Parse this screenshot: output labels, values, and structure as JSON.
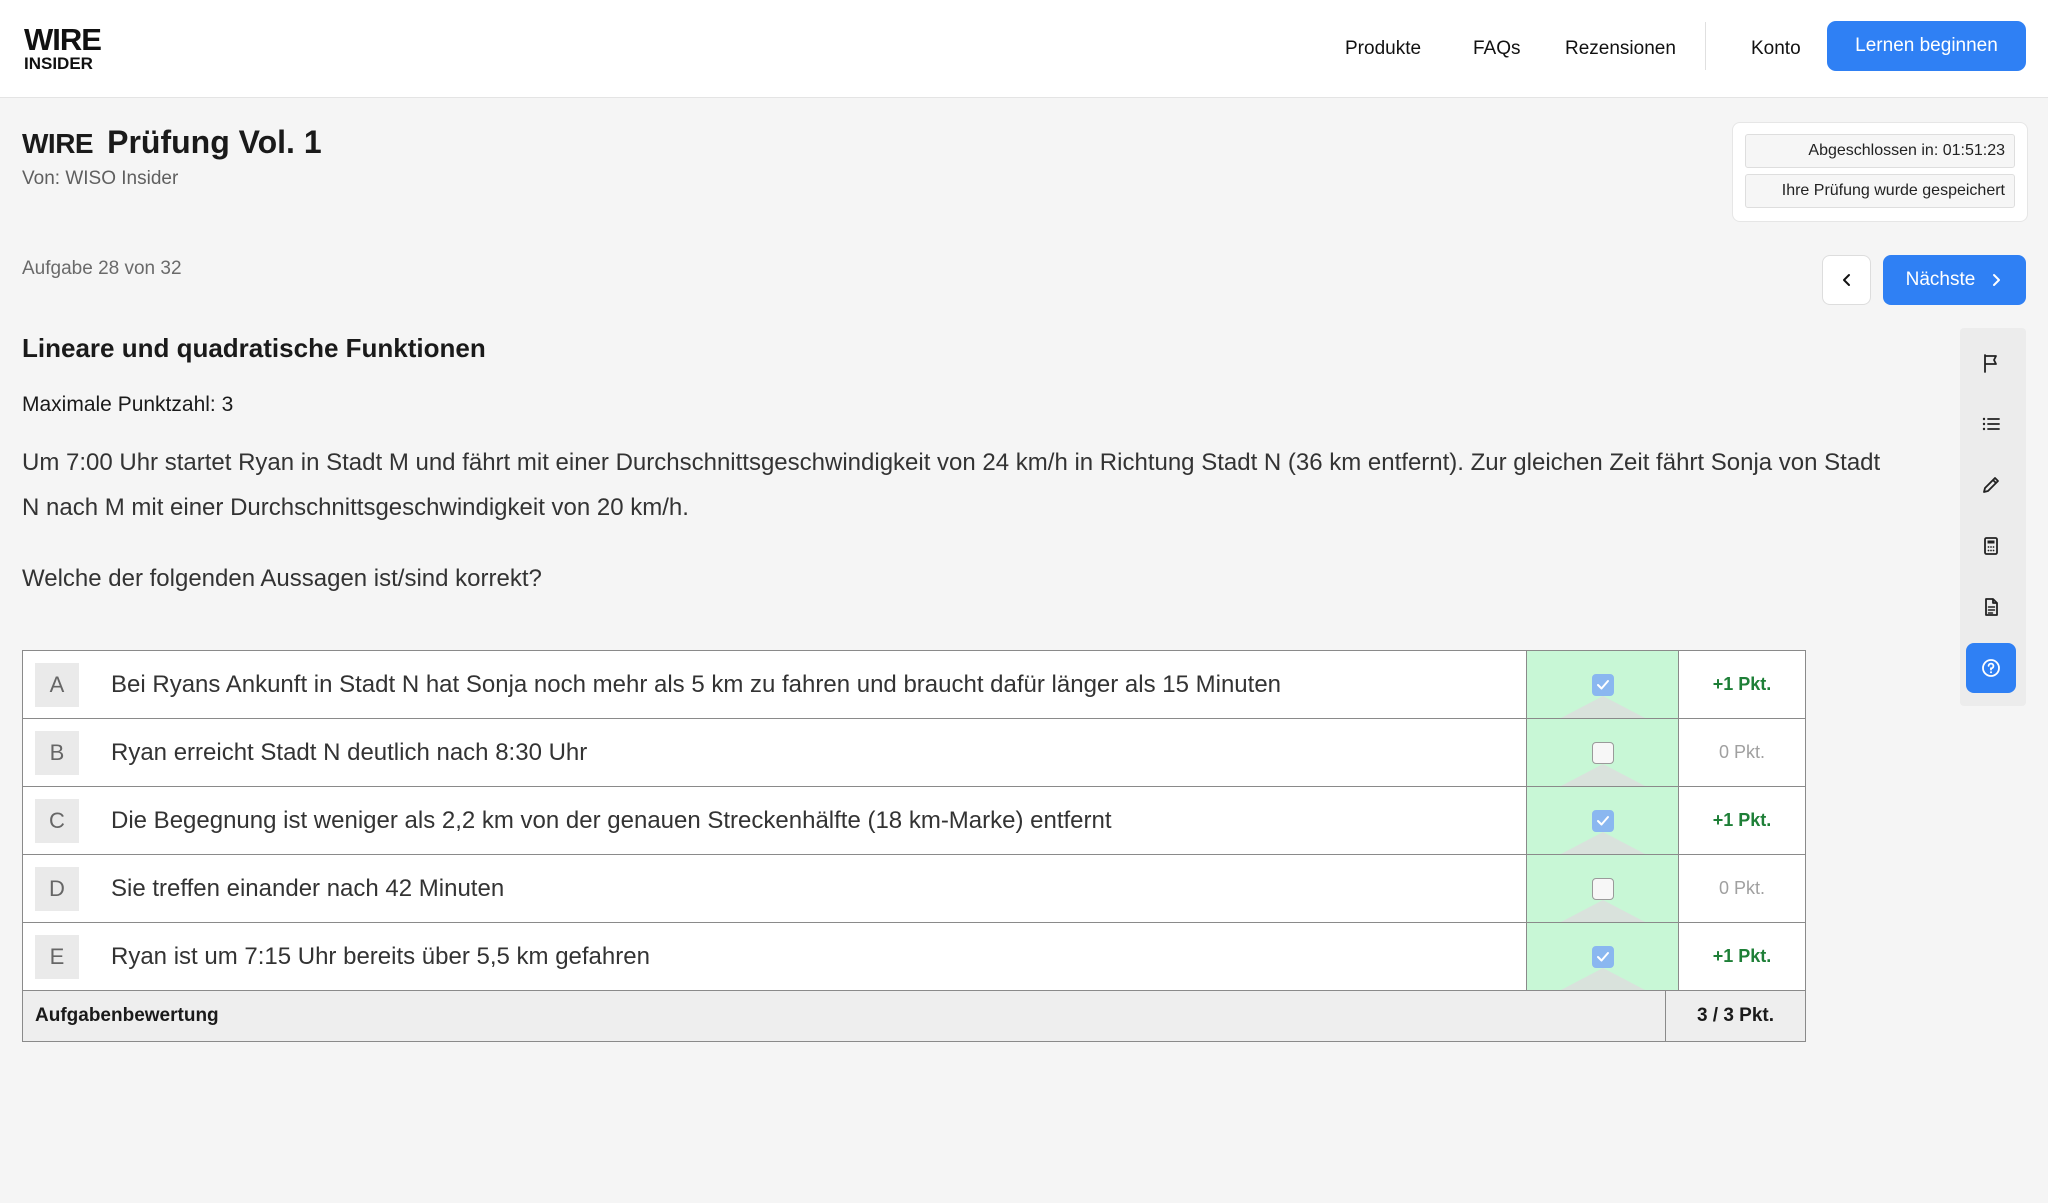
{
  "header": {
    "logo_line1": "WIRE",
    "logo_line2": "INSIDER",
    "nav": [
      "Produkte",
      "FAQs",
      "Rezensionen"
    ],
    "account": "Konto",
    "cta": "Lernen beginnen"
  },
  "exam": {
    "brand": "WIRE",
    "title": "Prüfung Vol. 1",
    "author": "Von: WISO Insider",
    "status_completed": "Abgeschlossen in: 01:51:23",
    "status_saved": "Ihre Prüfung wurde gespeichert"
  },
  "navigation": {
    "counter": "Aufgabe 28 von 32",
    "next": "Nächste"
  },
  "question": {
    "topic": "Lineare und quadratische Funktionen",
    "max_points": "Maximale Punktzahl: 3",
    "text": "Um 7:00 Uhr startet Ryan in Stadt M und fährt mit einer Durchschnittsgeschwindigkeit von 24 km/h in Richtung Stadt N (36 km entfernt). Zur gleichen Zeit fährt Sonja von Stadt N nach M mit einer Durchschnittsgeschwindigkeit von 20 km/h.",
    "prompt": "Welche der folgenden Aussagen ist/sind korrekt?"
  },
  "answers": [
    {
      "letter": "A",
      "text": "Bei Ryans Ankunft in Stadt N hat Sonja noch mehr als 5 km zu fahren und braucht dafür länger als 15 Minuten",
      "checked": true,
      "points": "+1 Pkt."
    },
    {
      "letter": "B",
      "text": "Ryan erreicht Stadt N deutlich nach 8:30 Uhr",
      "checked": false,
      "points": "0 Pkt."
    },
    {
      "letter": "C",
      "text": "Die Begegnung ist weniger als 2,2 km von der genauen Streckenhälfte (18 km-Marke) entfernt",
      "checked": true,
      "points": "+1 Pkt."
    },
    {
      "letter": "D",
      "text": "Sie treffen einander nach 42 Minuten",
      "checked": false,
      "points": "0 Pkt."
    },
    {
      "letter": "E",
      "text": "Ryan ist um 7:15 Uhr bereits über 5,5 km gefahren",
      "checked": true,
      "points": "+1 Pkt."
    }
  ],
  "score": {
    "label": "Aufgabenbewertung",
    "value": "3 / 3 Pkt."
  },
  "tools": [
    "flag-icon",
    "list-icon",
    "pencil-icon",
    "calculator-icon",
    "document-icon",
    "help-icon"
  ],
  "colors": {
    "primary": "#2f80f4",
    "correct_bg": "#c8f7d6",
    "points_green": "#1e7f37"
  }
}
